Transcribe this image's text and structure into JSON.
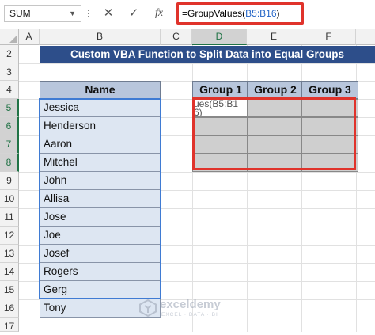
{
  "formula_bar": {
    "name_box": "SUM",
    "cancel_glyph": "✕",
    "enter_glyph": "✓",
    "fx_glyph": "fx",
    "formula_prefix": "=GroupValues(",
    "formula_ref": "B5:B16",
    "formula_suffix": ")"
  },
  "columns": [
    "A",
    "B",
    "C",
    "D",
    "E",
    "F"
  ],
  "rows": [
    "2",
    "3",
    "4",
    "5",
    "6",
    "7",
    "8",
    "9",
    "10",
    "11",
    "12",
    "13",
    "14",
    "15",
    "16",
    "17"
  ],
  "title": "Custom VBA Function to Split Data into Equal Groups",
  "names": {
    "header": "Name",
    "items": [
      "Jessica",
      "Henderson",
      "Aaron",
      "Mitchel",
      "John",
      "Allisa",
      "Jose",
      "Joe",
      "Josef",
      "Rogers",
      "Gerg",
      "Tony"
    ]
  },
  "groups": {
    "headers": [
      "Group 1",
      "Group 2",
      "Group 3"
    ],
    "active_cell_text": "ues(B5:B1 6)"
  },
  "watermark": {
    "brand": "exceldemy",
    "tagline": "EXCEL · DATA · BI"
  },
  "colors": {
    "title_bg": "#2d4e8a",
    "header_bg": "#b8c6dc",
    "name_cell_bg": "#dde6f2",
    "group_cell_bg": "#cfcfcf",
    "highlight_red": "#e0332b",
    "selection_blue": "#3f7bd3",
    "excel_green": "#217346"
  }
}
